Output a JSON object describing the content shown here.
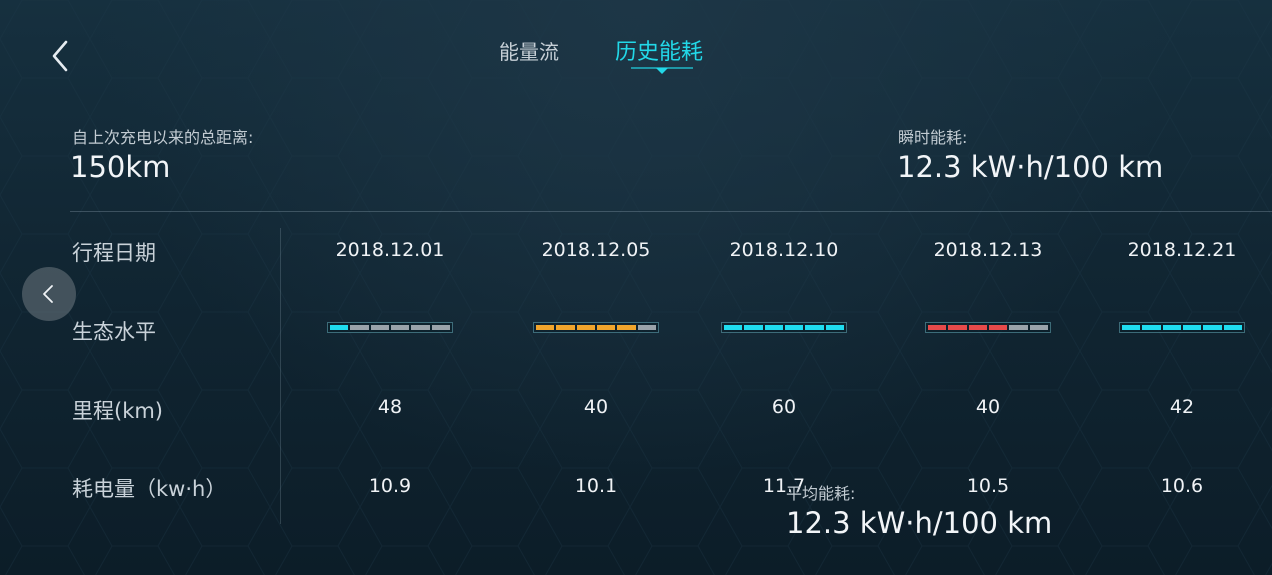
{
  "tabs": [
    {
      "label": "能量流",
      "active": false
    },
    {
      "label": "历史能耗",
      "active": true
    }
  ],
  "stats": {
    "total_distance_label": "自上次充电以来的总距离:",
    "total_distance_value": "150km",
    "instant_label": "瞬时能耗:",
    "instant_value": "12.3 kW·h/100 km",
    "average_label": "平均能耗:",
    "average_value": "12.3 kW·h/100 km"
  },
  "table": {
    "row_labels": {
      "date": "行程日期",
      "eco": "生态水平",
      "mileage": "里程(km)",
      "consumption": "耗电量（kw·h）"
    },
    "trips": [
      {
        "date": "2018.12.01",
        "mileage": "48",
        "consumption": "10.9",
        "eco_level": 1,
        "eco_color": "#1fdcef"
      },
      {
        "date": "2018.12.05",
        "mileage": "40",
        "consumption": "10.1",
        "eco_level": 5,
        "eco_color": "#f0a52c"
      },
      {
        "date": "2018.12.10",
        "mileage": "60",
        "consumption": "11.7",
        "eco_level": 6,
        "eco_color": "#1fdcef"
      },
      {
        "date": "2018.12.13",
        "mileage": "40",
        "consumption": "10.5",
        "eco_level": 4,
        "eco_color": "#e64a4a"
      },
      {
        "date": "2018.12.21",
        "mileage": "42",
        "consumption": "10.6",
        "eco_level": 6,
        "eco_color": "#1fdcef"
      }
    ],
    "eco_segments": 6,
    "eco_inactive_color": "#9aa3aa"
  },
  "icons": {
    "back": "chevron-left-icon",
    "prev": "chevron-left-icon"
  },
  "colors": {
    "accent": "#22d8e8",
    "text": "#f0f3f6",
    "muted": "#c2cbd2"
  }
}
